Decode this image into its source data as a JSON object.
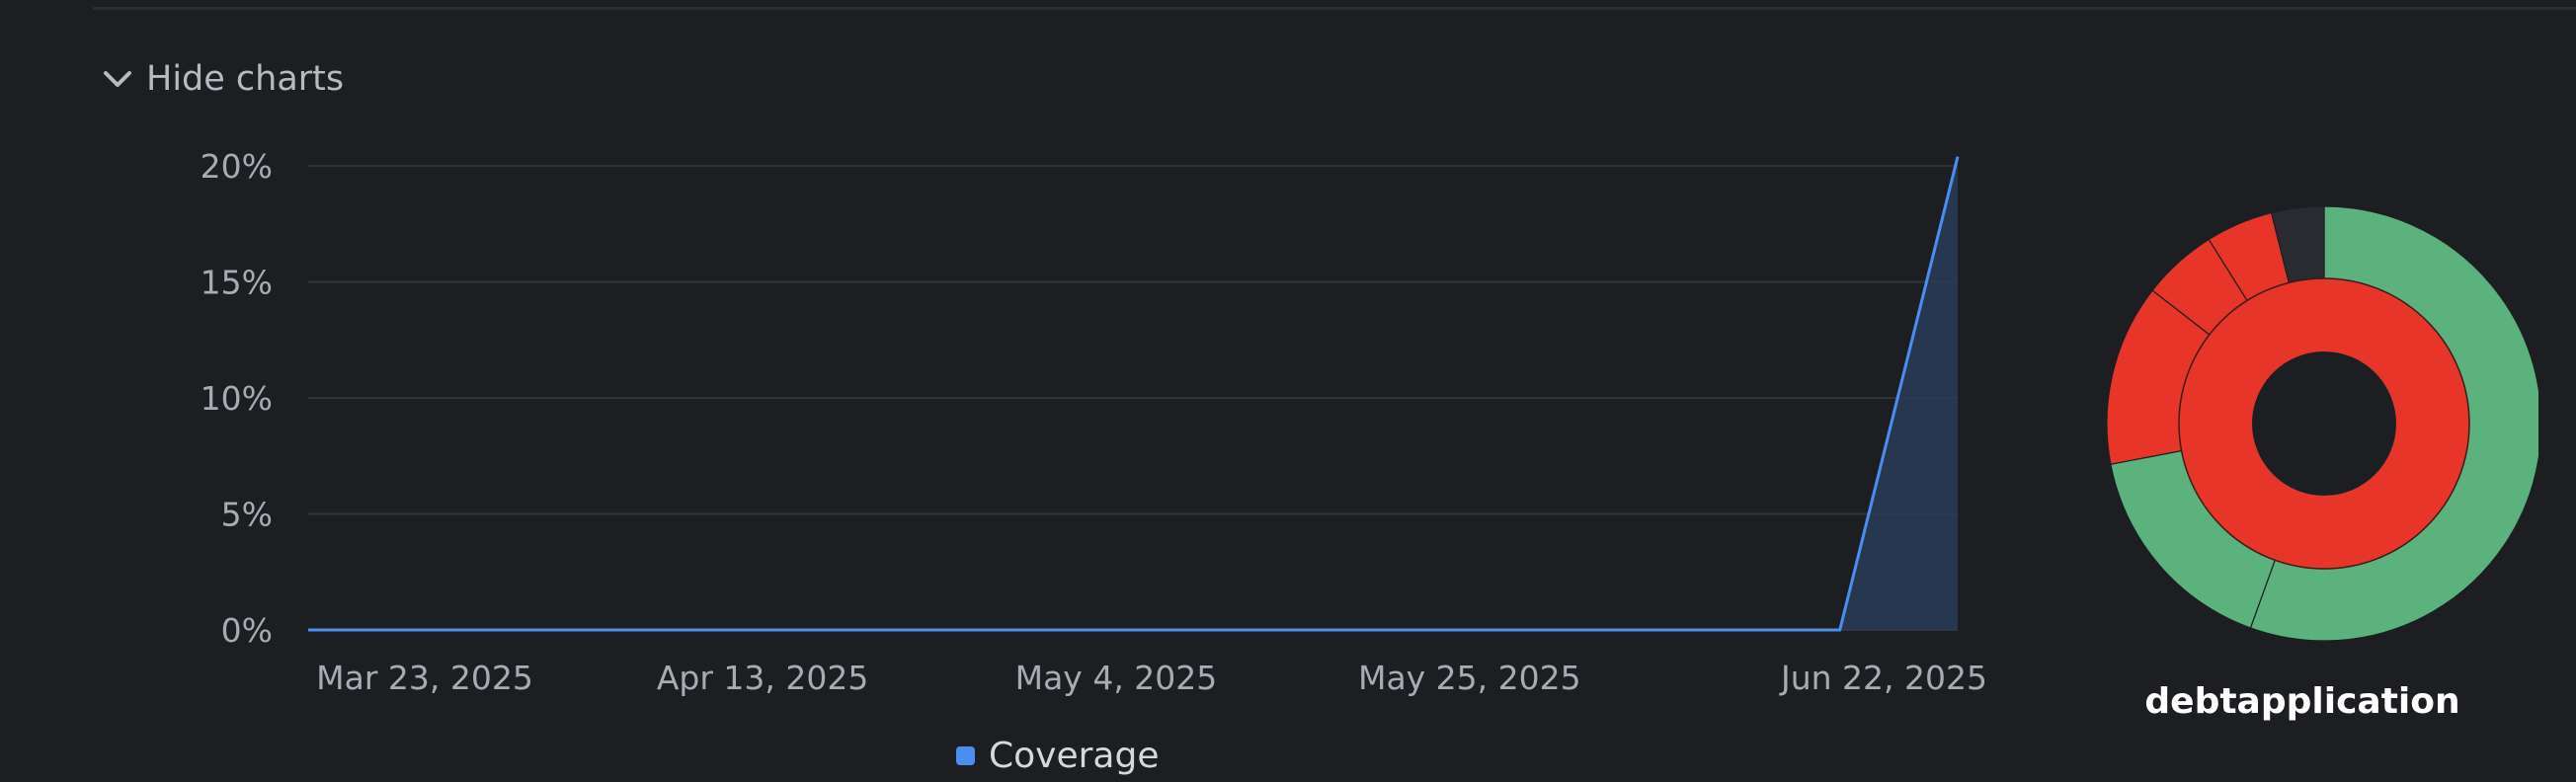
{
  "controls": {
    "toggle_label": "Hide charts"
  },
  "chart_data": [
    {
      "type": "area",
      "x": [
        "2025-03-17",
        "2025-06-16",
        "2025-06-23"
      ],
      "xticks": [
        "Mar 23, 2025",
        "Apr 13, 2025",
        "May 4, 2025",
        "May 25, 2025",
        "Jun 22, 2025"
      ],
      "yticks": [
        "0%",
        "5%",
        "10%",
        "15%",
        "20%"
      ],
      "series": [
        {
          "name": "Coverage",
          "values": [
            0,
            0,
            20.4
          ]
        }
      ],
      "ylim": [
        0,
        20
      ],
      "grid": true,
      "legend": "bottom",
      "colors": {
        "line": "#4a8ef0",
        "fill": "#2a3c58"
      }
    },
    {
      "type": "pie",
      "title": "debtapplication",
      "rings": [
        {
          "ring": "outer",
          "slices": [
            {
              "value": 55.5,
              "color": "#5bb27c"
            },
            {
              "value": 16.5,
              "color": "#5bb27c"
            },
            {
              "value": 13.5,
              "color": "#e8352a"
            },
            {
              "value": 5.6,
              "color": "#e8352a"
            },
            {
              "value": 5.0,
              "color": "#e8352a"
            },
            {
              "value": 3.9,
              "color": "#2a2b30"
            }
          ]
        },
        {
          "ring": "inner",
          "slices": [
            {
              "value": 100,
              "color": "#e8352a"
            }
          ]
        }
      ]
    }
  ]
}
